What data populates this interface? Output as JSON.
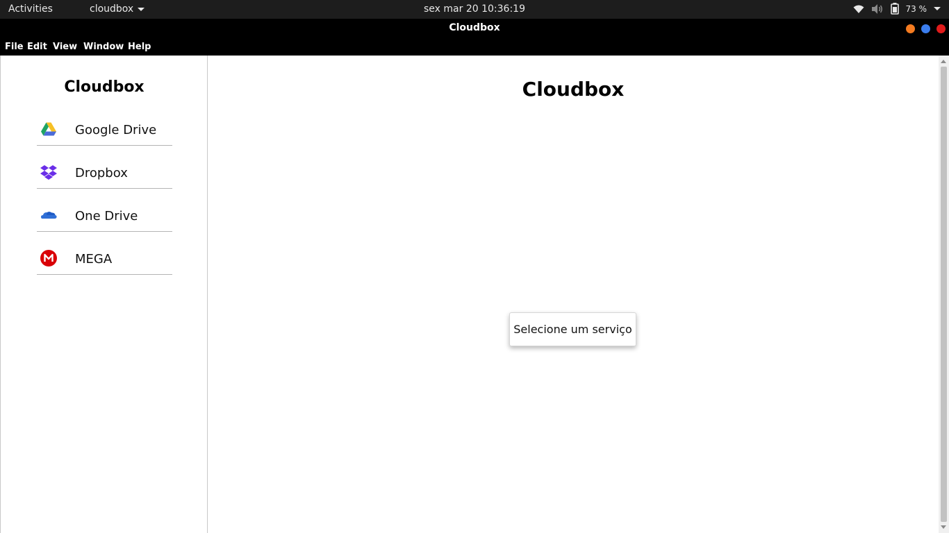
{
  "system_bar": {
    "activities": "Activities",
    "app_menu": "cloudbox",
    "clock": "sex mar 20  10:36:19",
    "battery": "73 %"
  },
  "window": {
    "title": "Cloudbox"
  },
  "menu": {
    "file": "File",
    "edit": "Edit",
    "view": "View",
    "window": "Window",
    "help": "Help"
  },
  "sidebar": {
    "title": "Cloudbox",
    "items": [
      {
        "label": "Google Drive",
        "icon": "google-drive-icon"
      },
      {
        "label": "Dropbox",
        "icon": "dropbox-icon"
      },
      {
        "label": "One Drive",
        "icon": "onedrive-icon"
      },
      {
        "label": "MEGA",
        "icon": "mega-icon"
      }
    ]
  },
  "main": {
    "title": "Cloudbox",
    "message": "Selecione um serviço"
  },
  "colors": {
    "window_min": "#f47b20",
    "window_max": "#3b7ded",
    "window_close": "#e01b1b",
    "dropbox": "#6a2ee8",
    "onedrive": "#2f6fd6",
    "mega": "#d90007"
  }
}
